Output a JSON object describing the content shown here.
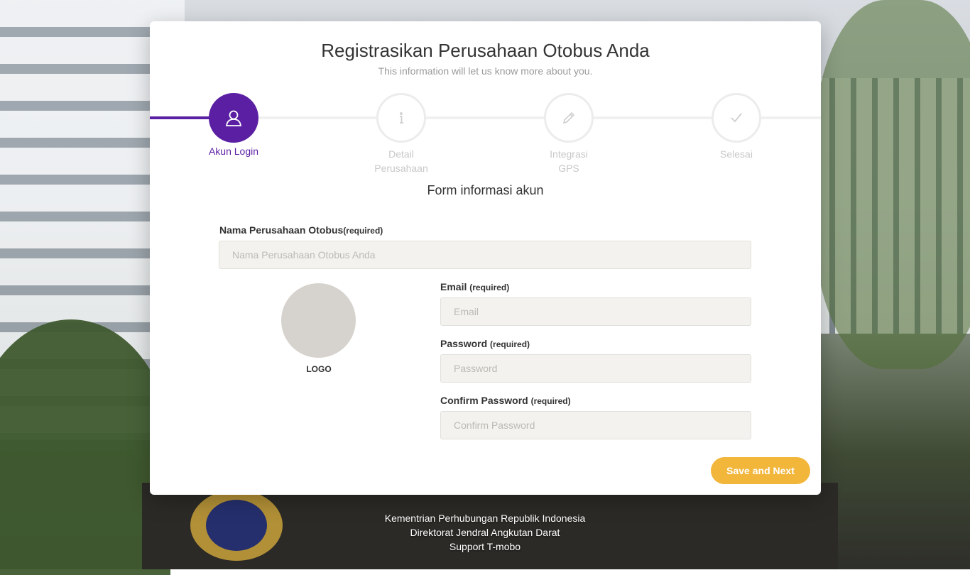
{
  "header": {
    "title": "Registrasikan Perusahaan Otobus Anda",
    "subtitle": "This information will let us know more about you."
  },
  "wizard": {
    "steps": [
      {
        "label": "Akun Login",
        "icon": "user-icon",
        "active": true
      },
      {
        "label": "Detail Perusahaan",
        "icon": "info-icon",
        "active": false
      },
      {
        "label": "Integrasi GPS",
        "icon": "pencil-icon",
        "active": false
      },
      {
        "label": "Selesai",
        "icon": "check-icon",
        "active": false
      }
    ],
    "accent_color": "#5b1fa3"
  },
  "form": {
    "section_title": "Form informasi akun",
    "company_name": {
      "label": "Nama Perusahaan Otobus",
      "required": "(required)",
      "placeholder": "Nama Perusahaan Otobus Anda",
      "value": ""
    },
    "email": {
      "label": "Email",
      "required": "(required)",
      "placeholder": "Email",
      "value": ""
    },
    "password": {
      "label": "Password",
      "required": "(required)",
      "placeholder": "Password",
      "value": ""
    },
    "confirm_password": {
      "label": "Confirm Password",
      "required": "(required)",
      "placeholder": "Confirm Password",
      "value": ""
    },
    "logo_label": "LOGO",
    "save_label": "Save and Next",
    "button_color": "#f2b63b"
  },
  "footer": {
    "line1": "Kementrian Perhubungan Republik Indonesia",
    "line2": "Direktorat Jendral Angkutan Darat",
    "line3": "Support T-mobo"
  }
}
